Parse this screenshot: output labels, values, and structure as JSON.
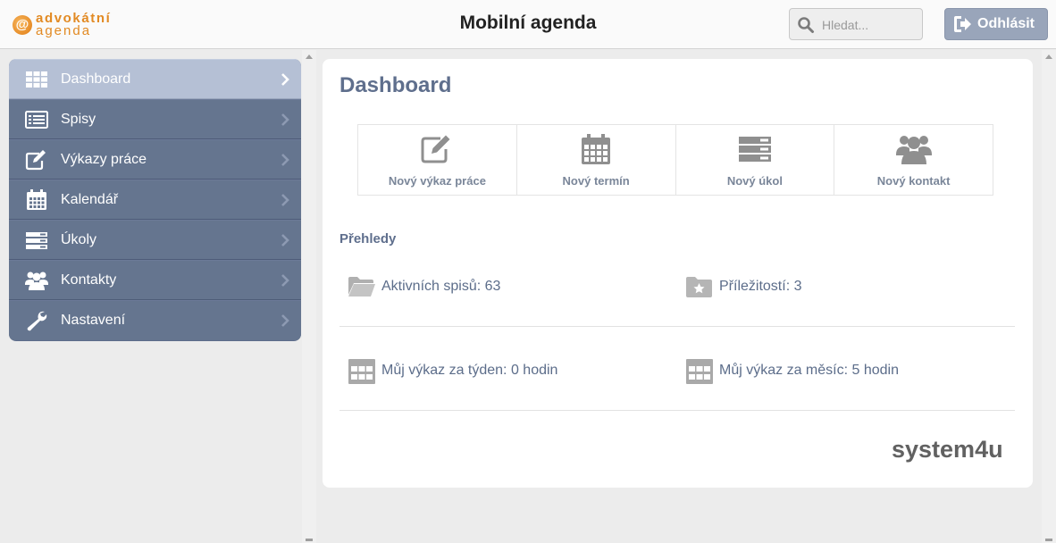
{
  "header": {
    "logo_line1": "advokátní",
    "logo_line2": "agenda",
    "title": "Mobilní agenda",
    "search_placeholder": "Hledat...",
    "logout_label": "Odhlásit"
  },
  "sidebar": {
    "items": [
      {
        "label": "Dashboard",
        "icon": "grid-icon",
        "active": true
      },
      {
        "label": "Spisy",
        "icon": "list-icon"
      },
      {
        "label": "Výkazy práce",
        "icon": "edit-icon"
      },
      {
        "label": "Kalendář",
        "icon": "calendar-icon"
      },
      {
        "label": "Úkoly",
        "icon": "tasks-icon"
      },
      {
        "label": "Kontakty",
        "icon": "users-icon"
      },
      {
        "label": "Nastavení",
        "icon": "wrench-icon"
      }
    ]
  },
  "main": {
    "title": "Dashboard",
    "actions": [
      {
        "label": "Nový výkaz práce",
        "icon": "edit-icon"
      },
      {
        "label": "Nový termín",
        "icon": "calendar-icon"
      },
      {
        "label": "Nový úkol",
        "icon": "tasks-icon"
      },
      {
        "label": "Nový kontakt",
        "icon": "users-icon"
      }
    ],
    "overview_title": "Přehledy",
    "stats": [
      {
        "label": "Aktivních spisů: 63",
        "icon": "folder-icon"
      },
      {
        "label": "Příležitostí: 3",
        "icon": "folder-star-icon"
      },
      {
        "label": "Můj výkaz za týden: 0 hodin",
        "icon": "calendar-grid-icon"
      },
      {
        "label": "Můj výkaz za měsíc: 5 hodin",
        "icon": "calendar-grid-icon"
      }
    ],
    "brand_text": "system4u"
  },
  "colors": {
    "accent": "#5f6f8d",
    "sidebar_bg": "#65758f",
    "sidebar_active": "#b5c0d5",
    "logo_orange": "#e28a23",
    "logout_bg": "#99a5ba"
  }
}
